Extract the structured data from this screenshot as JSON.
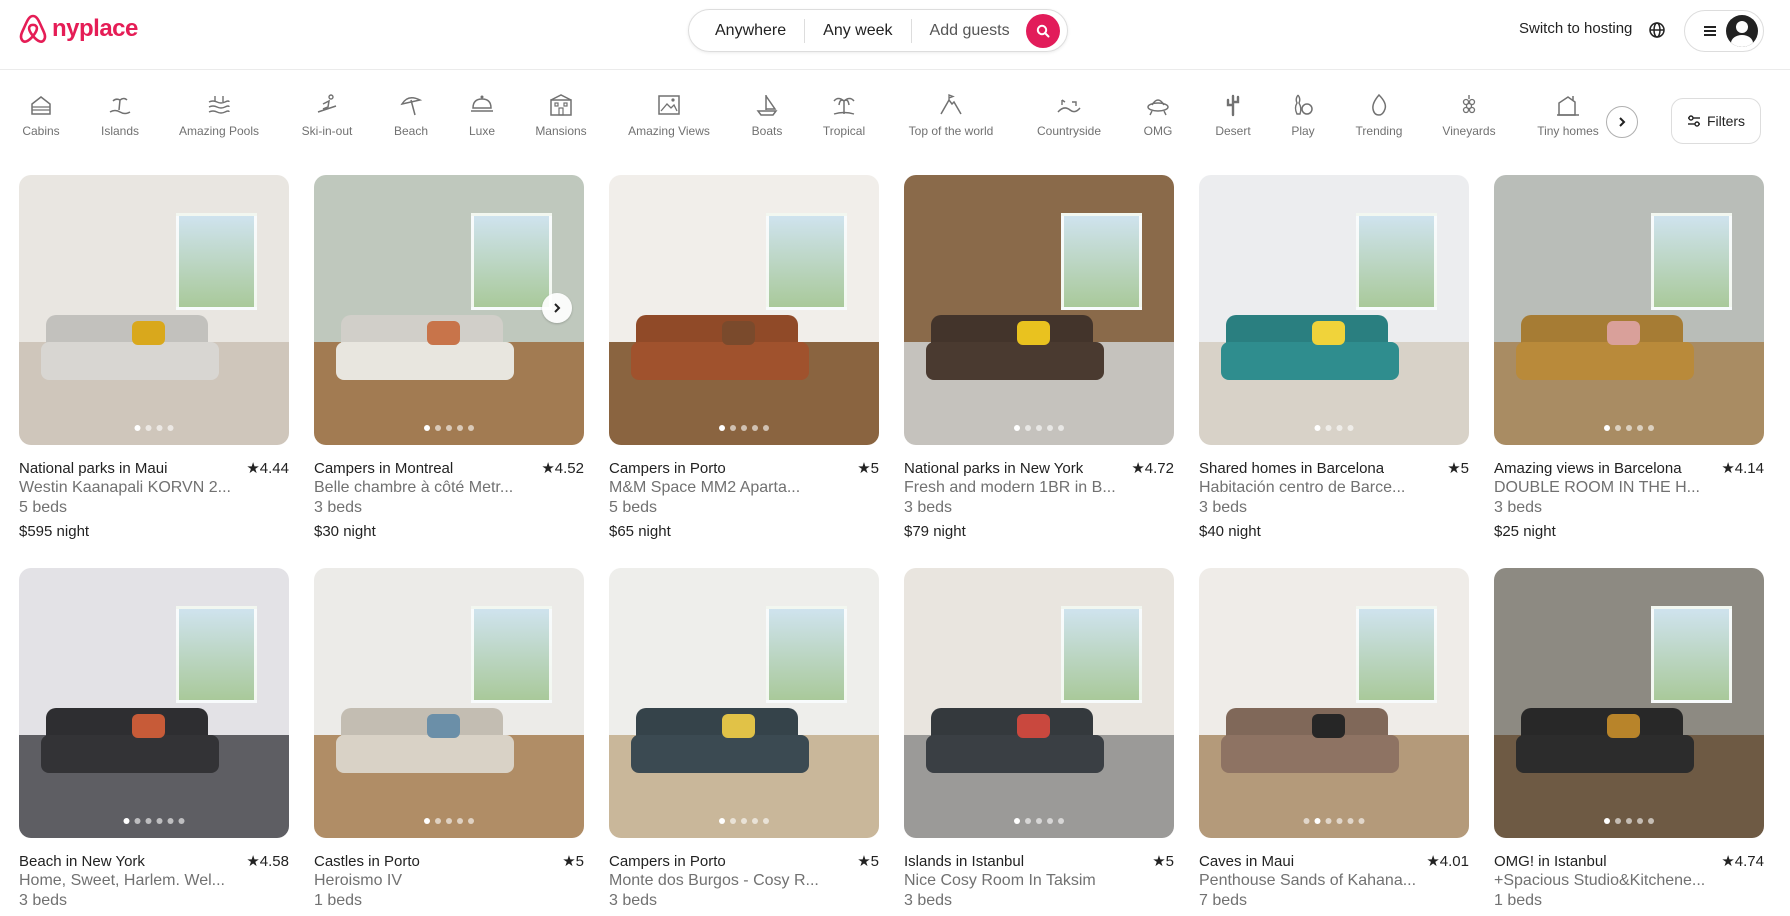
{
  "brand": {
    "name": "nyplace",
    "color": "#e51d56"
  },
  "search": {
    "where": "Anywhere",
    "when": "Any week",
    "who": "Add guests"
  },
  "header": {
    "host_link": "Switch to hosting"
  },
  "categories": [
    {
      "label": "Cabins",
      "icon": "cabin-icon"
    },
    {
      "label": "Islands",
      "icon": "island-icon"
    },
    {
      "label": "Amazing Pools",
      "icon": "pool-icon"
    },
    {
      "label": "Ski-in-out",
      "icon": "ski-icon"
    },
    {
      "label": "Beach",
      "icon": "beach-umbrella-icon"
    },
    {
      "label": "Luxe",
      "icon": "cloche-icon"
    },
    {
      "label": "Mansions",
      "icon": "mansion-icon"
    },
    {
      "label": "Amazing Views",
      "icon": "picture-frame-icon"
    },
    {
      "label": "Boats",
      "icon": "sailboat-icon"
    },
    {
      "label": "Tropical",
      "icon": "palm-icon"
    },
    {
      "label": "Top of the world",
      "icon": "mountain-peak-icon"
    },
    {
      "label": "Countryside",
      "icon": "countryside-icon"
    },
    {
      "label": "OMG",
      "icon": "ufo-icon"
    },
    {
      "label": "Desert",
      "icon": "cactus-icon"
    },
    {
      "label": "Play",
      "icon": "bowling-icon"
    },
    {
      "label": "Trending",
      "icon": "flame-icon"
    },
    {
      "label": "Vineyards",
      "icon": "grapes-icon"
    },
    {
      "label": "Tiny homes",
      "icon": "tiny-home-icon"
    }
  ],
  "filters": {
    "label": "Filters"
  },
  "listings": [
    {
      "title": "National parks in Maui",
      "rating": "★4.44",
      "name": "Westin Kaanapali KORVN 2...",
      "beds": "5 beds",
      "price": "$595",
      "per": "night"
    },
    {
      "title": "Campers in Montreal",
      "rating": "★4.52",
      "name": "Belle chambre à côté Metr...",
      "beds": "3 beds",
      "price": "$30",
      "per": "night"
    },
    {
      "title": "Campers in Porto",
      "rating": "★5",
      "name": "M&M Space MM2 Aparta...",
      "beds": "5 beds",
      "price": "$65",
      "per": "night"
    },
    {
      "title": "National parks in New York",
      "rating": "★4.72",
      "name": "Fresh and modern 1BR in B...",
      "beds": "3 beds",
      "price": "$79",
      "per": "night"
    },
    {
      "title": "Shared homes in Barcelona",
      "rating": "★5",
      "name": "Habitación centro de Barce...",
      "beds": "3 beds",
      "price": "$40",
      "per": "night"
    },
    {
      "title": "Amazing views in Barcelona",
      "rating": "★4.14",
      "name": "DOUBLE ROOM IN THE H...",
      "beds": "3 beds",
      "price": "$25",
      "per": "night"
    },
    {
      "title": "Beach in New York",
      "rating": "★4.58",
      "name": "Home, Sweet, Harlem. Wel...",
      "beds": "3 beds",
      "price": "",
      "per": ""
    },
    {
      "title": "Castles in Porto",
      "rating": "★5",
      "name": "Heroismo IV",
      "beds": "1 beds",
      "price": "",
      "per": ""
    },
    {
      "title": "Campers in Porto",
      "rating": "★5",
      "name": "Monte dos Burgos - Cosy R...",
      "beds": "3 beds",
      "price": "",
      "per": ""
    },
    {
      "title": "Islands in Istanbul",
      "rating": "★5",
      "name": "Nice Cosy Room In Taksim",
      "beds": "3 beds",
      "price": "",
      "per": ""
    },
    {
      "title": "Caves in Maui",
      "rating": "★4.01",
      "name": "Penthouse Sands of Kahana...",
      "beds": "7 beds",
      "price": "",
      "per": ""
    },
    {
      "title": "OMG! in Istanbul",
      "rating": "★4.74",
      "name": "+Spacious Studio&Kitchene...",
      "beds": "1 beds",
      "price": "",
      "per": ""
    }
  ]
}
